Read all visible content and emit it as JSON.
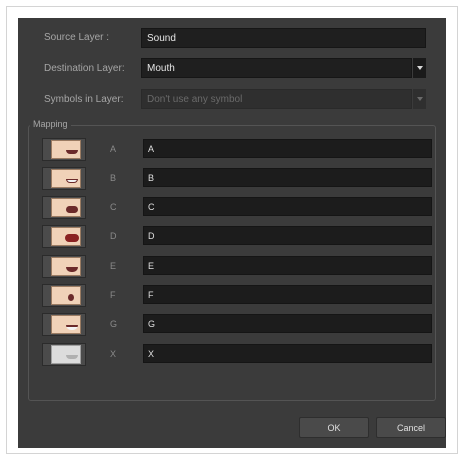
{
  "source_layer": {
    "label": "Source Layer :",
    "value": "Sound"
  },
  "destination_layer": {
    "label": "Destination Layer:",
    "value": "Mouth"
  },
  "symbols_in_layer": {
    "label": "Symbols in Layer:",
    "value": "Don't use any symbol"
  },
  "mapping": {
    "title": "Mapping",
    "rows": [
      {
        "letter": "A",
        "value": "A",
        "icon": "mouth-closed-icon"
      },
      {
        "letter": "B",
        "value": "B",
        "icon": "mouth-teeth-icon"
      },
      {
        "letter": "C",
        "value": "C",
        "icon": "mouth-open-icon"
      },
      {
        "letter": "D",
        "value": "D",
        "icon": "mouth-wide-open-icon"
      },
      {
        "letter": "E",
        "value": "E",
        "icon": "mouth-e-icon"
      },
      {
        "letter": "F",
        "value": "F",
        "icon": "mouth-round-icon"
      },
      {
        "letter": "G",
        "value": "G",
        "icon": "mouth-teeth-lip-icon"
      },
      {
        "letter": "X",
        "value": "X",
        "icon": "mouth-rest-icon"
      }
    ]
  },
  "buttons": {
    "ok": "OK",
    "cancel": "Cancel"
  }
}
